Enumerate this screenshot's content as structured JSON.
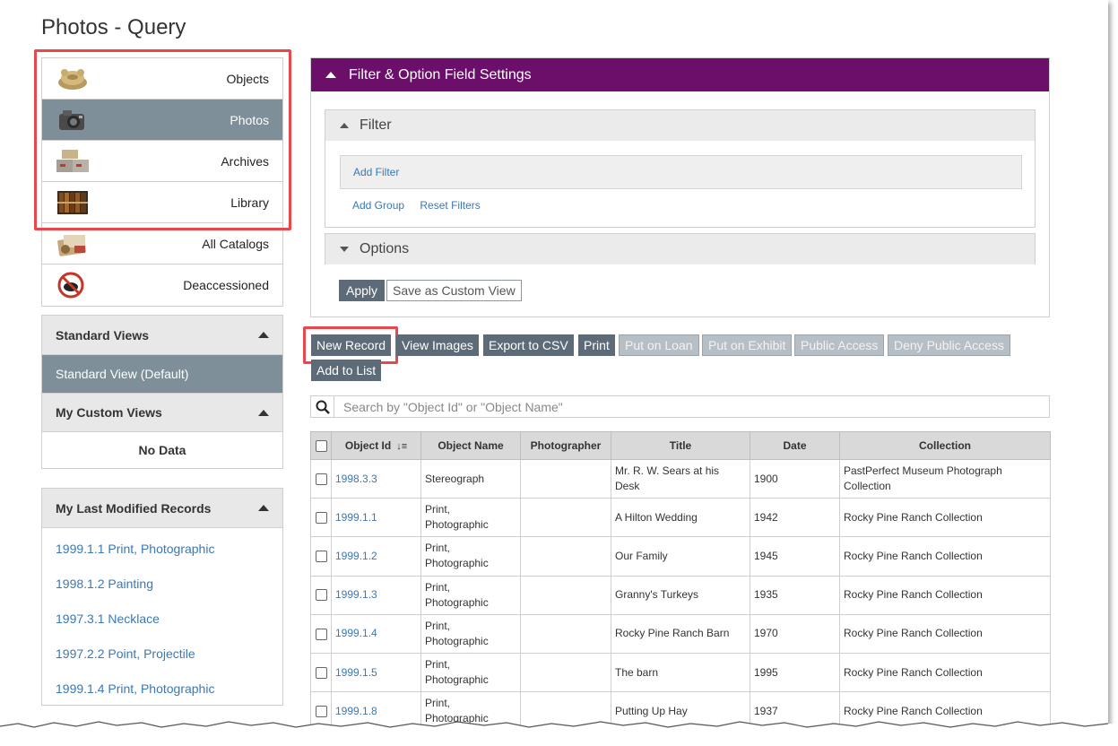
{
  "page": {
    "title": "Photos - Query"
  },
  "catalogs": [
    {
      "label": "Objects",
      "icon": "artifact-icon",
      "active": false
    },
    {
      "label": "Photos",
      "icon": "camera-icon",
      "active": true
    },
    {
      "label": "Archives",
      "icon": "archive-boxes-icon",
      "active": false
    },
    {
      "label": "Library",
      "icon": "books-icon",
      "active": false
    },
    {
      "label": "All Catalogs",
      "icon": "all-catalogs-icon",
      "active": false
    },
    {
      "label": "Deaccessioned",
      "icon": "deaccessioned-icon",
      "active": false
    }
  ],
  "views": {
    "standard_title": "Standard Views",
    "standard_default": "Standard View (Default)",
    "custom_title": "My Custom Views",
    "custom_empty": "No Data"
  },
  "recent": {
    "title": "My Last Modified Records",
    "items": [
      "1999.1.1 Print, Photographic",
      "1998.1.2 Painting",
      "1997.3.1 Necklace",
      "1997.2.2 Point, Projectile",
      "1999.1.4 Print, Photographic"
    ]
  },
  "filter": {
    "header": "Filter & Option Field Settings",
    "filter_title": "Filter",
    "add_filter": "Add Filter",
    "add_group": "Add Group",
    "reset_filters": "Reset Filters",
    "options_title": "Options",
    "apply": "Apply",
    "save_custom_view": "Save as Custom View"
  },
  "toolbar": {
    "new_record": "New Record",
    "view_images": "View Images",
    "export_csv": "Export to CSV",
    "print": "Print",
    "put_on_loan": "Put on Loan",
    "put_on_exhibit": "Put on Exhibit",
    "public_access": "Public Access",
    "deny_public_access": "Deny Public Access",
    "add_to_list": "Add to List"
  },
  "search": {
    "placeholder": "Search by \"Object Id\" or \"Object Name\""
  },
  "table": {
    "columns": [
      "Object Id",
      "Object Name",
      "Photographer",
      "Title",
      "Date",
      "Collection"
    ],
    "rows": [
      {
        "id": "1998.3.3",
        "name": "Stereograph",
        "photographer": "",
        "title": "Mr. R. W. Sears at his Desk",
        "date": "1900",
        "collection": "PastPerfect Museum Photograph Collection"
      },
      {
        "id": "1999.1.1",
        "name": "Print, Photographic",
        "photographer": "",
        "title": "A Hilton Wedding",
        "date": "1942",
        "collection": "Rocky Pine Ranch Collection"
      },
      {
        "id": "1999.1.2",
        "name": "Print, Photographic",
        "photographer": "",
        "title": "Our Family",
        "date": "1945",
        "collection": "Rocky Pine Ranch Collection"
      },
      {
        "id": "1999.1.3",
        "name": "Print, Photographic",
        "photographer": "",
        "title": "Granny's Turkeys",
        "date": "1935",
        "collection": "Rocky Pine Ranch Collection"
      },
      {
        "id": "1999.1.4",
        "name": "Print, Photographic",
        "photographer": "",
        "title": "Rocky Pine Ranch Barn",
        "date": "1970",
        "collection": "Rocky Pine Ranch Collection"
      },
      {
        "id": "1999.1.5",
        "name": "Print, Photographic",
        "photographer": "",
        "title": "The barn",
        "date": "1995",
        "collection": "Rocky Pine Ranch Collection"
      },
      {
        "id": "1999.1.8",
        "name": "Print, Photographic",
        "photographer": "",
        "title": "Putting Up Hay",
        "date": "1937",
        "collection": "Rocky Pine Ranch Collection"
      }
    ]
  },
  "colors": {
    "accent_header": "#6b0f6b",
    "active_item": "#7f8f9a",
    "button": "#5d6b78",
    "link": "#3a78b5",
    "highlight": "#e8474c"
  }
}
